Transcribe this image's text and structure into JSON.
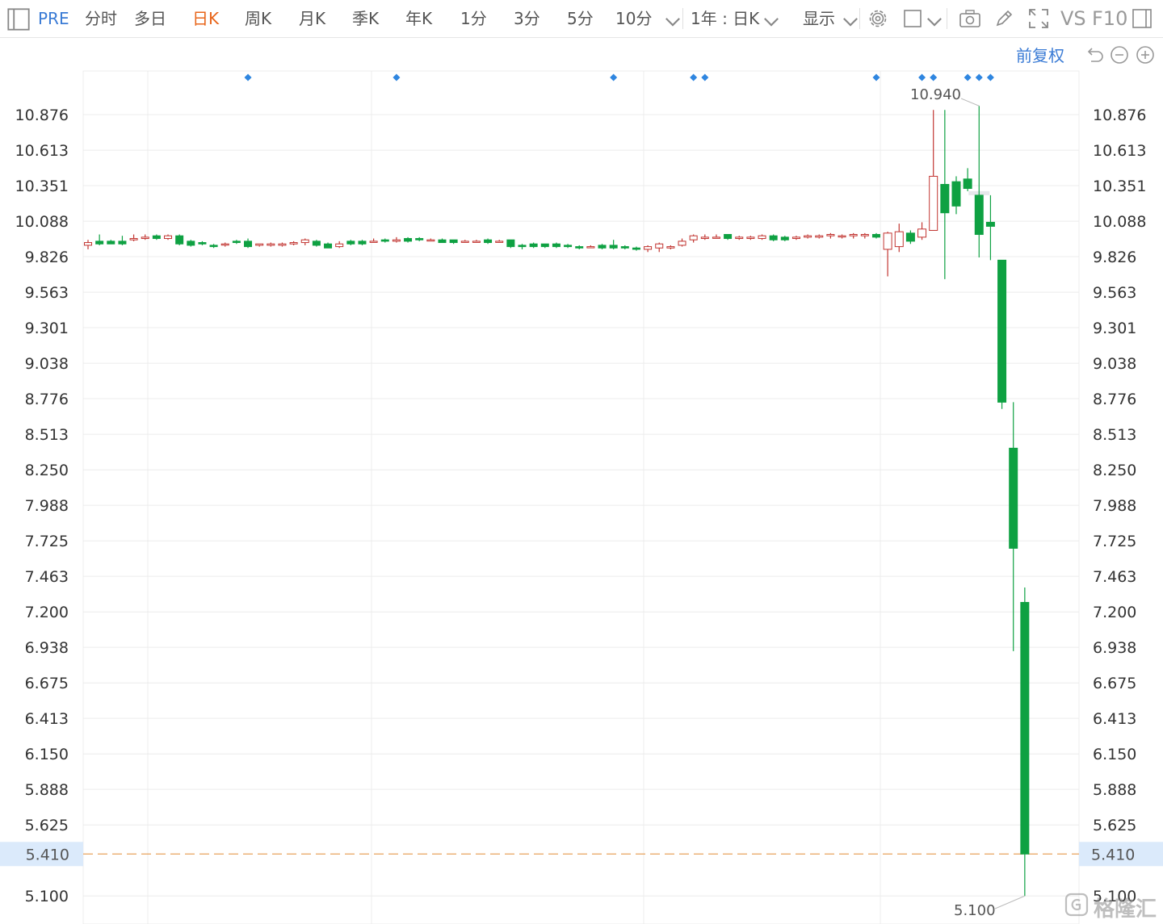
{
  "toolbar": {
    "ticker": "PRE",
    "tabs": [
      "分时",
      "多日",
      "日K",
      "周K",
      "月K",
      "季K",
      "年K",
      "1分",
      "3分",
      "5分",
      "10分"
    ],
    "active_tab": "日K",
    "range_select": "1年 : 日K",
    "display_label": "显示",
    "vs_label": "VS",
    "f10_label": "F10"
  },
  "controls": {
    "adjust_label": "前复权"
  },
  "colors": {
    "up": "#c23531",
    "down": "#0ea142",
    "grid": "#ececec",
    "price_line": "#e8a35c",
    "accent": "#3a7bd5",
    "event_marker": "#2f86e0"
  },
  "chart_data": {
    "type": "candlestick",
    "y_ticks": [
      "10.876",
      "10.613",
      "10.351",
      "10.088",
      "9.826",
      "9.563",
      "9.301",
      "9.038",
      "8.776",
      "8.513",
      "8.250",
      "7.988",
      "7.725",
      "7.463",
      "7.200",
      "6.938",
      "6.675",
      "6.413",
      "6.150",
      "5.888",
      "5.625",
      "5.100"
    ],
    "ylim": [
      4.9,
      11.2
    ],
    "max_label": "10.940",
    "min_label": "5.100",
    "current_price": 5.41,
    "current_label": "5.410",
    "event_markers": [
      14,
      27,
      46,
      53,
      54,
      69,
      73,
      74,
      77,
      78,
      79
    ],
    "gap_bar": 78,
    "candles": [
      [
        9.91,
        9.93,
        9.88,
        9.95
      ],
      [
        9.94,
        9.92,
        9.91,
        9.99
      ],
      [
        9.94,
        9.92,
        9.92,
        9.95
      ],
      [
        9.94,
        9.92,
        9.91,
        9.98
      ],
      [
        9.95,
        9.96,
        9.94,
        9.99
      ],
      [
        9.96,
        9.97,
        9.95,
        9.99
      ],
      [
        9.98,
        9.96,
        9.95,
        9.99
      ],
      [
        9.96,
        9.98,
        9.95,
        9.99
      ],
      [
        9.98,
        9.92,
        9.91,
        9.99
      ],
      [
        9.94,
        9.91,
        9.9,
        9.95
      ],
      [
        9.93,
        9.92,
        9.91,
        9.94
      ],
      [
        9.91,
        9.9,
        9.89,
        9.92
      ],
      [
        9.92,
        9.92,
        9.9,
        9.93
      ],
      [
        9.94,
        9.93,
        9.92,
        9.95
      ],
      [
        9.94,
        9.9,
        9.89,
        9.96
      ],
      [
        9.91,
        9.92,
        9.9,
        9.92
      ],
      [
        9.91,
        9.92,
        9.9,
        9.93
      ],
      [
        9.91,
        9.92,
        9.9,
        9.93
      ],
      [
        9.92,
        9.93,
        9.91,
        9.94
      ],
      [
        9.93,
        9.95,
        9.91,
        9.96
      ],
      [
        9.94,
        9.91,
        9.9,
        9.95
      ],
      [
        9.92,
        9.89,
        9.89,
        9.93
      ],
      [
        9.9,
        9.92,
        9.89,
        9.94
      ],
      [
        9.94,
        9.92,
        9.91,
        9.95
      ],
      [
        9.94,
        9.92,
        9.91,
        9.95
      ],
      [
        9.94,
        9.94,
        9.93,
        9.96
      ],
      [
        9.95,
        9.94,
        9.93,
        9.96
      ],
      [
        9.94,
        9.95,
        9.93,
        9.97
      ],
      [
        9.96,
        9.94,
        9.93,
        9.97
      ],
      [
        9.96,
        9.95,
        9.94,
        9.97
      ],
      [
        9.95,
        9.95,
        9.94,
        9.96
      ],
      [
        9.95,
        9.93,
        9.93,
        9.96
      ],
      [
        9.95,
        9.93,
        9.92,
        9.95
      ],
      [
        9.94,
        9.94,
        9.93,
        9.95
      ],
      [
        9.94,
        9.94,
        9.93,
        9.95
      ],
      [
        9.95,
        9.93,
        9.92,
        9.96
      ],
      [
        9.94,
        9.94,
        9.93,
        9.95
      ],
      [
        9.95,
        9.9,
        9.89,
        9.95
      ],
      [
        9.91,
        9.9,
        9.88,
        9.92
      ],
      [
        9.92,
        9.9,
        9.89,
        9.93
      ],
      [
        9.92,
        9.9,
        9.89,
        9.92
      ],
      [
        9.92,
        9.9,
        9.89,
        9.93
      ],
      [
        9.91,
        9.9,
        9.89,
        9.92
      ],
      [
        9.9,
        9.89,
        9.88,
        9.91
      ],
      [
        9.9,
        9.9,
        9.89,
        9.91
      ],
      [
        9.91,
        9.89,
        9.88,
        9.92
      ],
      [
        9.91,
        9.89,
        9.88,
        9.95
      ],
      [
        9.9,
        9.89,
        9.88,
        9.91
      ],
      [
        9.89,
        9.88,
        9.87,
        9.9
      ],
      [
        9.88,
        9.9,
        9.86,
        9.91
      ],
      [
        9.89,
        9.92,
        9.86,
        9.93
      ],
      [
        9.89,
        9.9,
        9.88,
        9.91
      ],
      [
        9.91,
        9.94,
        9.9,
        9.96
      ],
      [
        9.95,
        9.98,
        9.93,
        9.99
      ],
      [
        9.96,
        9.97,
        9.95,
        9.99
      ],
      [
        9.97,
        9.97,
        9.96,
        9.99
      ],
      [
        9.99,
        9.96,
        9.95,
        9.99
      ],
      [
        9.96,
        9.97,
        9.95,
        9.98
      ],
      [
        9.96,
        9.97,
        9.95,
        9.98
      ],
      [
        9.96,
        9.98,
        9.95,
        9.99
      ],
      [
        9.98,
        9.95,
        9.94,
        9.99
      ],
      [
        9.97,
        9.95,
        9.94,
        9.98
      ],
      [
        9.96,
        9.97,
        9.95,
        9.98
      ],
      [
        9.97,
        9.98,
        9.96,
        9.99
      ],
      [
        9.97,
        9.98,
        9.96,
        9.99
      ],
      [
        9.98,
        9.99,
        9.96,
        10.0
      ],
      [
        9.98,
        9.98,
        9.96,
        9.99
      ],
      [
        9.98,
        9.99,
        9.96,
        10.0
      ],
      [
        9.98,
        9.99,
        9.96,
        10.0
      ],
      [
        9.99,
        9.97,
        9.96,
        10.0
      ],
      [
        9.88,
        10.0,
        9.68,
        10.01
      ],
      [
        9.9,
        10.01,
        9.86,
        10.07
      ],
      [
        10.0,
        9.94,
        9.92,
        10.02
      ],
      [
        9.97,
        10.03,
        9.95,
        10.08
      ],
      [
        10.02,
        10.42,
        10.02,
        10.91
      ],
      [
        10.36,
        10.15,
        9.66,
        10.91
      ],
      [
        10.38,
        10.2,
        10.14,
        10.42
      ],
      [
        10.4,
        10.33,
        10.31,
        10.48
      ],
      [
        10.28,
        9.99,
        9.82,
        10.94
      ],
      [
        10.08,
        10.05,
        9.8,
        10.28
      ],
      [
        9.8,
        8.75,
        8.7,
        9.8
      ],
      [
        8.41,
        7.67,
        6.91,
        8.75
      ],
      [
        7.27,
        5.41,
        5.1,
        7.38
      ]
    ]
  }
}
